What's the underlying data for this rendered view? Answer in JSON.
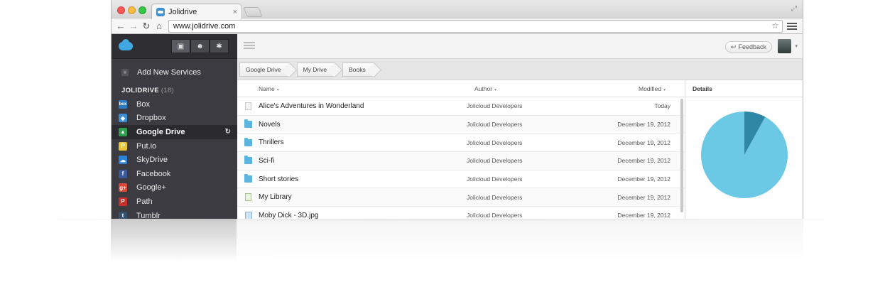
{
  "browser": {
    "tab_title": "Jolidrive",
    "tab_close": "×",
    "url": "www.jolidrive.com",
    "back": "←",
    "forward": "→",
    "reload": "↻",
    "home": "⌂",
    "star": "☆",
    "fullscreen": "⤢"
  },
  "sidebar": {
    "add_services_label": "Add New Services",
    "add_plus": "+",
    "group_title": "JOLIDRIVE",
    "group_count": "(18)",
    "tools": [
      "▣",
      "☻",
      "✱"
    ],
    "items": [
      {
        "label": "Box",
        "icon": "box-icon",
        "color": "#2a7bc4",
        "glyph": "box",
        "active": false
      },
      {
        "label": "Dropbox",
        "icon": "dropbox-icon",
        "color": "#3d8fd1",
        "glyph": "◆",
        "active": false
      },
      {
        "label": "Google Drive",
        "icon": "google-drive-icon",
        "color": "#2f9e4f",
        "glyph": "▲",
        "active": true
      },
      {
        "label": "Put.io",
        "icon": "putio-icon",
        "color": "#e7c43a",
        "glyph": "P",
        "active": false
      },
      {
        "label": "SkyDrive",
        "icon": "skydrive-icon",
        "color": "#2f82d6",
        "glyph": "☁",
        "active": false
      },
      {
        "label": "Facebook",
        "icon": "facebook-icon",
        "color": "#3b5998",
        "glyph": "f",
        "active": false
      },
      {
        "label": "Google+",
        "icon": "google-plus-icon",
        "color": "#d64937",
        "glyph": "g+",
        "active": false
      },
      {
        "label": "Path",
        "icon": "path-icon",
        "color": "#c9302c",
        "glyph": "P",
        "active": false
      },
      {
        "label": "Tumblr",
        "icon": "tumblr-icon",
        "color": "#34526f",
        "glyph": "t",
        "active": false
      }
    ],
    "refresh": "↻"
  },
  "header": {
    "feedback_label": "Feedback",
    "feedback_icon": "↩",
    "avatar_caret": "▾"
  },
  "breadcrumb": [
    "Google Drive",
    "My Drive",
    "Books"
  ],
  "list": {
    "columns": {
      "name": "Name",
      "author": "Author",
      "modified": "Modified"
    },
    "caret": "▾",
    "rows": [
      {
        "name": "Alice's Adventures in Wonderland",
        "author": "Jolicloud Developers",
        "modified": "Today",
        "type": "doc"
      },
      {
        "name": "Novels",
        "author": "Jolicloud Developers",
        "modified": "December 19, 2012",
        "type": "folder"
      },
      {
        "name": "Thrillers",
        "author": "Jolicloud Developers",
        "modified": "December 19, 2012",
        "type": "folder"
      },
      {
        "name": "Sci-fi",
        "author": "Jolicloud Developers",
        "modified": "December 19, 2012",
        "type": "folder"
      },
      {
        "name": "Short stories",
        "author": "Jolicloud Developers",
        "modified": "December 19, 2012",
        "type": "folder"
      },
      {
        "name": "My Library",
        "author": "Jolicloud Developers",
        "modified": "December 19, 2012",
        "type": "sheet"
      },
      {
        "name": "Moby Dick - 3D.jpg",
        "author": "Jolicloud Developers",
        "modified": "December 19, 2012",
        "type": "image"
      }
    ]
  },
  "details": {
    "title": "Details",
    "colors": {
      "main": "#6cc9e6",
      "slice": "#2f87a6"
    },
    "pie_fractions": [
      0.92,
      0.08
    ]
  }
}
